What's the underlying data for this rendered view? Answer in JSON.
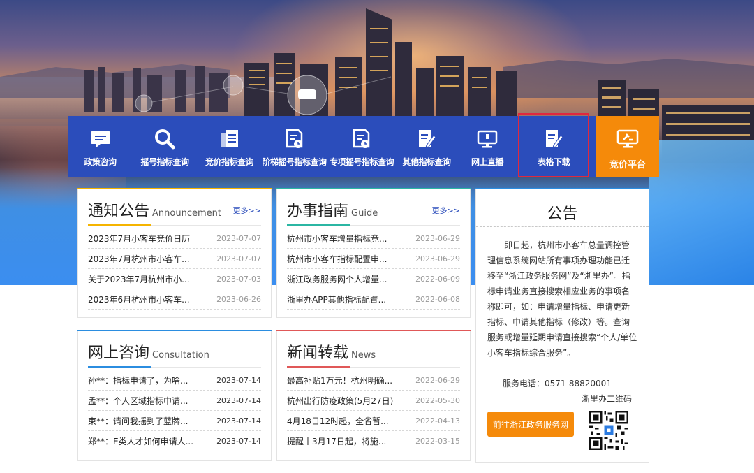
{
  "nav": {
    "items": [
      {
        "label": "政策咨询",
        "icon": "chat-bubble-icon"
      },
      {
        "label": "摇号指标查询",
        "icon": "search-icon"
      },
      {
        "label": "竞价指标查询",
        "icon": "documents-icon"
      },
      {
        "label": "阶梯摇号指标查询",
        "icon": "document-clock-icon"
      },
      {
        "label": "专项摇号指标查询",
        "icon": "document-clock-icon"
      },
      {
        "label": "其他指标查询",
        "icon": "document-pen-icon"
      },
      {
        "label": "网上直播",
        "icon": "monitor-icon"
      },
      {
        "label": "表格下载",
        "icon": "document-pen-icon"
      }
    ],
    "special": {
      "label": "竞价平台",
      "icon": "monitor-gavel-icon"
    },
    "active_index": 7,
    "colors": {
      "bar": "#2b4dbb",
      "special": "#f58a0a",
      "highlight": "#e0283e"
    }
  },
  "panels": {
    "announcement": {
      "title": "通知公告",
      "subtitle": "Announcement",
      "more": "更多>>",
      "accent": "#f5b400",
      "items": [
        {
          "title": "2023年7月小客车竞价日历",
          "date": "2023-07-07"
        },
        {
          "title": "2023年7月杭州市小客车...",
          "date": "2023-07-07"
        },
        {
          "title": "关于2023年7月杭州市小...",
          "date": "2023-07-03"
        },
        {
          "title": "2023年6月杭州市小客车...",
          "date": "2023-06-26"
        }
      ]
    },
    "guide": {
      "title": "办事指南",
      "subtitle": "Guide",
      "more": "更多>>",
      "accent": "#2bb6a3",
      "items": [
        {
          "title": "杭州市小客车增量指标竞...",
          "date": "2023-06-29"
        },
        {
          "title": "杭州市小客车指标配置申...",
          "date": "2023-06-29"
        },
        {
          "title": "浙江政务服务网个人增量...",
          "date": "2022-06-09"
        },
        {
          "title": "浙里办APP其他指标配置...",
          "date": "2022-06-08"
        }
      ]
    },
    "consultation": {
      "title": "网上咨询",
      "subtitle": "Consultation",
      "accent": "#2b8de0",
      "items": [
        {
          "title": "孙**：指标申请了，为啥...",
          "date": "2023-07-14"
        },
        {
          "title": "孟**：个人区域指标申请...",
          "date": "2023-07-14"
        },
        {
          "title": "束**：请问我摇到了蓝牌...",
          "date": "2023-07-14"
        },
        {
          "title": "郑**：E类人才如何申请人...",
          "date": "2023-07-14"
        }
      ]
    },
    "news": {
      "title": "新闻转载",
      "subtitle": "News",
      "accent": "#e05858",
      "items": [
        {
          "title": "最高补贴1万元！杭州明确...",
          "date": "2022-06-29"
        },
        {
          "title": "杭州出行防疫政策(5月27日)",
          "date": "2022-05-30"
        },
        {
          "title": "4月18日12时起，全省暂...",
          "date": "2022-04-13"
        },
        {
          "title": "提醒丨3月17日起，将施...",
          "date": "2022-03-15"
        }
      ]
    },
    "notice": {
      "title": "公告",
      "accent": "#2b8de0",
      "body": "即日起，杭州市小客车总量调控管理信息系统网站所有事项办理功能已迁移至“浙江政务服务网”及“浙里办”。指标申请业务直接搜索相应业务的事项名称即可，如：申请增量指标、申请更新指标、申请其他指标（修改）等。查询服务或增量延期申请直接搜索“个人/单位小客车指标综合服务”。",
      "phone": "服务电话：0571-88820001",
      "qr_label": "浙里办二维码",
      "button": "前往浙江政务服务网"
    }
  }
}
